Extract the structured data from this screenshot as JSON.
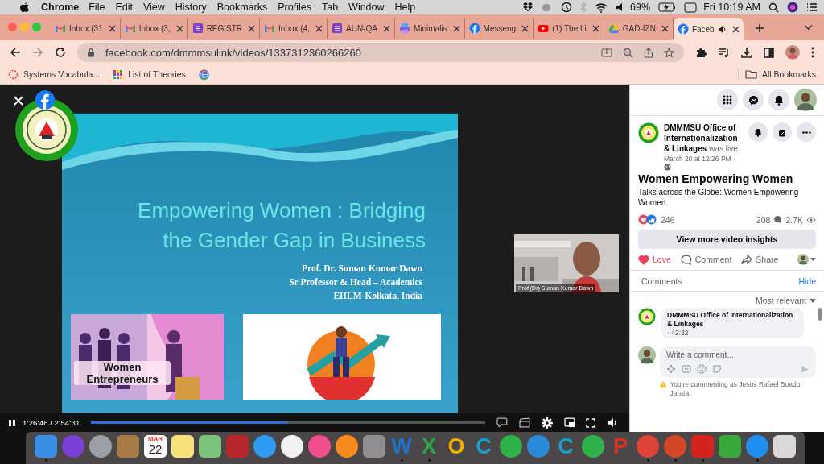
{
  "menubar": {
    "app": "Chrome",
    "menus": [
      "File",
      "Edit",
      "View",
      "History",
      "Bookmarks",
      "Profiles",
      "Tab",
      "Window",
      "Help"
    ],
    "battery": "69%",
    "clock": "Fri 10:19 AM"
  },
  "tabs": [
    {
      "title": "Inbox (31",
      "kind": "gmail",
      "selected": false,
      "audio": false
    },
    {
      "title": "Inbox (3,",
      "kind": "gmail",
      "selected": false,
      "audio": false
    },
    {
      "title": "REGISTR",
      "kind": "forms",
      "selected": false,
      "audio": false
    },
    {
      "title": "Inbox (4,",
      "kind": "gmail",
      "selected": false,
      "audio": false
    },
    {
      "title": "AUN-QA",
      "kind": "forms",
      "selected": false,
      "audio": false
    },
    {
      "title": "Minimalis",
      "kind": "printer",
      "selected": false,
      "audio": false
    },
    {
      "title": "Messeng",
      "kind": "facebook",
      "selected": false,
      "audio": false
    },
    {
      "title": "(1) The Li",
      "kind": "youtube",
      "selected": false,
      "audio": false
    },
    {
      "title": "GAD-IZN",
      "kind": "drive",
      "selected": false,
      "audio": false
    },
    {
      "title": "Faceb",
      "kind": "facebook",
      "selected": true,
      "audio": true
    }
  ],
  "address": {
    "url": "facebook.com/dmmmsulink/videos/1337312360266260"
  },
  "bookmarks": [
    {
      "label": "Systems Vocabula...",
      "kind": "ring"
    },
    {
      "label": "List of Theories",
      "kind": "grid"
    },
    {
      "kind": "google"
    }
  ],
  "all_bookmarks": "All Bookmarks",
  "video": {
    "slide": {
      "title_lines": [
        "Empowering Women : Bridging",
        "the Gender Gap in Business"
      ],
      "presenter_lines": [
        "Prof. Dr. Suman Kumar Dawn",
        "Sr Professor & Head – Academics",
        "EIILM-Kolkata, India"
      ],
      "picture_caption": "Women Entrepreneurs"
    },
    "participant": "Prof (Dr) Suman Kumar Dawn",
    "time": "1:26:48 / 2:54:31",
    "progress": {
      "level": 0.5
    }
  },
  "post": {
    "header": "**DMMMSU Office of Internationalization & Linkages** was live.",
    "date": "March 20 at 12:26 PM ·",
    "title": "Women Empowering Women",
    "description": "Talks across the Globe: Women Empowering Women",
    "reactions": "246",
    "comments_count": "208",
    "views": "2.7K",
    "insights_button": "View more video insights",
    "actions": [
      {
        "label": "Love",
        "kind": "love",
        "selected": true
      },
      {
        "label": "Comment",
        "kind": "comment",
        "selected": false
      },
      {
        "label": "Share",
        "kind": "share",
        "selected": false
      }
    ]
  },
  "comments": {
    "heading": "Comments",
    "hide": "Hide",
    "sort": "Most relevant",
    "items": [
      {
        "author": "DMMMSU Office of Internationalization & Linkages",
        "text": "· 42:32"
      }
    ],
    "composer": {
      "placeholder": "Write a comment...",
      "notice": "You're commenting as Jesus Rafael Boado Jarata."
    }
  },
  "dock": [
    {
      "kind": "tile",
      "color": "#3a8ee6",
      "running": true
    },
    {
      "kind": "circle",
      "color": "#7b3fd6",
      "running": false
    },
    {
      "kind": "circle",
      "color": "#9aa0a6",
      "running": false
    },
    {
      "kind": "tile",
      "color": "#a87a44",
      "running": false
    },
    {
      "kind": "calendar",
      "color": "#e53935",
      "month": "MAR",
      "day": "22",
      "running": false
    },
    {
      "kind": "tile",
      "color": "#f7e27a",
      "running": false
    },
    {
      "kind": "tile",
      "color": "#7cc47c",
      "running": false
    },
    {
      "kind": "tile",
      "color": "#b8262b",
      "running": false
    },
    {
      "kind": "circle",
      "color": "#2f9bf0",
      "running": false
    },
    {
      "kind": "circle",
      "color": "#f2f2f2",
      "running": false
    },
    {
      "kind": "circle",
      "color": "#f04e8c",
      "running": false
    },
    {
      "kind": "circle",
      "color": "#f78a1d",
      "running": false
    },
    {
      "kind": "tile",
      "color": "#8e8e93",
      "running": false
    },
    {
      "kind": "letter",
      "color": "#1f73c8",
      "glyph": "W",
      "running": true
    },
    {
      "kind": "letter",
      "color": "#2aa64a",
      "glyph": "X",
      "running": true
    },
    {
      "kind": "letter",
      "color": "#f0b400",
      "glyph": "O",
      "running": false
    },
    {
      "kind": "letter",
      "color": "#19a0c8",
      "glyph": "C",
      "running": false
    },
    {
      "kind": "circle",
      "color": "#2fb24a",
      "running": false
    },
    {
      "kind": "circle",
      "color": "#2b8ad8",
      "running": false
    },
    {
      "kind": "letter",
      "color": "#19a0c8",
      "glyph": "C",
      "running": false
    },
    {
      "kind": "circle",
      "color": "#2fb24a",
      "running": false
    },
    {
      "kind": "letter",
      "color": "#e03020",
      "glyph": "P",
      "running": false
    },
    {
      "kind": "circle",
      "color": "#db4437",
      "running": true
    },
    {
      "kind": "circle",
      "color": "#d24726",
      "running": true
    },
    {
      "kind": "tile",
      "color": "#d4231f",
      "running": true
    },
    {
      "kind": "tile",
      "color": "#3aa83a",
      "running": false
    },
    {
      "kind": "circle",
      "color": "#1e8ff0",
      "running": true
    },
    {
      "kind": "tile",
      "color": "#d9d9d9",
      "running": false
    }
  ]
}
